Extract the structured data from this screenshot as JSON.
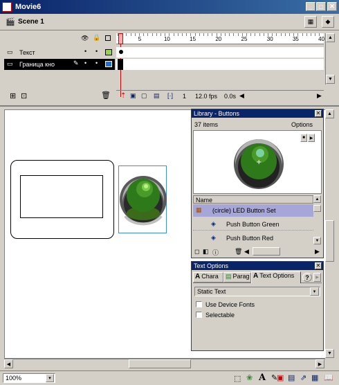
{
  "window": {
    "title": "Movie6"
  },
  "scene": {
    "label": "Scene 1"
  },
  "timeline": {
    "ruler": [
      "1",
      "5",
      "10",
      "15",
      "20",
      "25",
      "30",
      "35",
      "40"
    ],
    "layers": [
      {
        "name": "Текст",
        "color": "#9ad24a"
      },
      {
        "name": "Граница кно",
        "color": "#1f6fd8"
      }
    ],
    "frame": "1",
    "fps": "12.0 fps",
    "time": "0.0s"
  },
  "library": {
    "title": "Library - Buttons",
    "count": "37 items",
    "options": "Options",
    "column": "Name",
    "items": [
      "(circle) LED Button Set",
      "Push Button Green",
      "Push Button Red"
    ]
  },
  "text_options": {
    "title": "Text Options",
    "tabs": [
      "Chara",
      "Parag",
      "Text Options"
    ],
    "type": "Static Text",
    "use_device_fonts": "Use Device Fonts",
    "selectable": "Selectable"
  },
  "status": {
    "zoom": "100%"
  }
}
